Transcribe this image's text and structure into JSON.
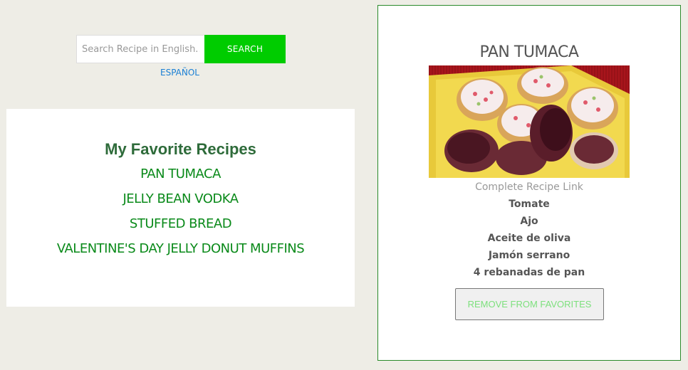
{
  "search": {
    "placeholder": "Search Recipe in English..",
    "button_label": "SEARCH",
    "language_link": "ESPAÑOL"
  },
  "favorites": {
    "title": "My Favorite Recipes",
    "items": [
      {
        "label": "PAN TUMACA"
      },
      {
        "label": "JELLY BEAN VODKA"
      },
      {
        "label": "STUFFED BREAD"
      },
      {
        "label": "VALENTINE'S DAY JELLY DONUT MUFFINS"
      }
    ]
  },
  "detail": {
    "title": "PAN TUMACA",
    "image_alt": "Pan tumaca dish on a yellow plate",
    "recipe_link_label": "Complete Recipe Link",
    "ingredients": [
      "Tomate",
      "Ajo",
      "Aceite de oliva",
      "Jamón serrano",
      "4 rebanadas de pan"
    ],
    "remove_button_label": "REMOVE FROM FAVORITES"
  },
  "colors": {
    "page_bg": "#eeede6",
    "search_button": "#00cc00",
    "link_blue": "#1a7fd4",
    "favorites_title": "#2e6b3a",
    "favorites_item": "#0a8a1a",
    "panel_border": "#2a8a2a",
    "remove_text": "#7de07d"
  }
}
